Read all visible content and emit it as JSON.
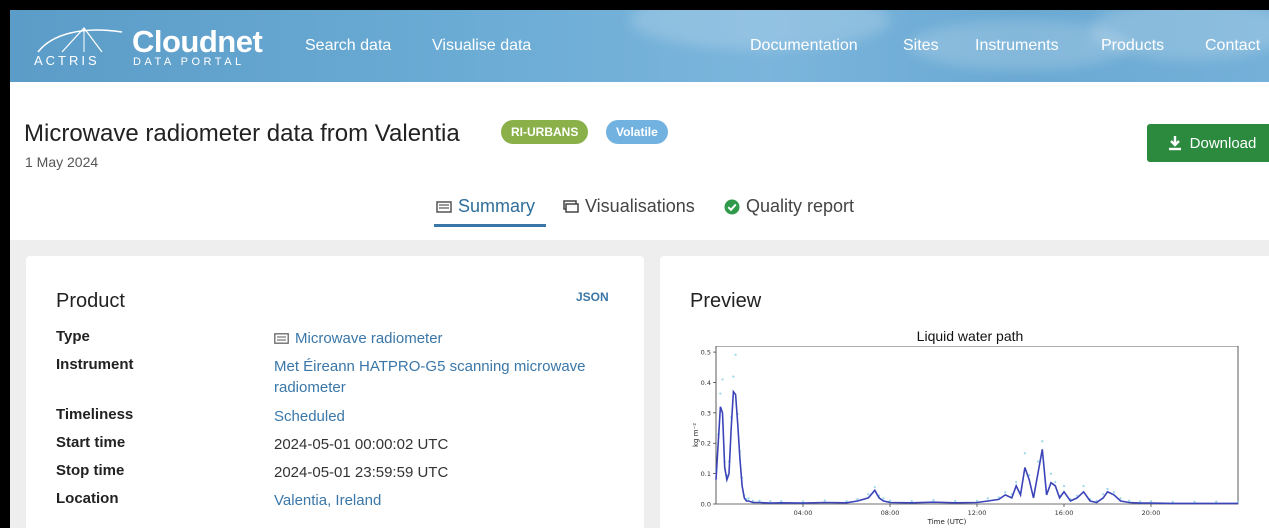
{
  "header": {
    "brand": "Cloudnet",
    "brand_sub": "DATA PORTAL",
    "org": "ACTRIS",
    "nav_left": [
      "Search data",
      "Visualise data"
    ],
    "nav_right": [
      "Documentation",
      "Sites",
      "Instruments",
      "Products",
      "Contact"
    ]
  },
  "page": {
    "title": "Microwave radiometer data from Valentia",
    "badges": [
      "RI-URBANS",
      "Volatile"
    ],
    "date": "1 May 2024",
    "download_label": "Download",
    "tabs": [
      "Summary",
      "Visualisations",
      "Quality report"
    ],
    "active_tab": "Summary"
  },
  "product": {
    "title": "Product",
    "json_label": "JSON",
    "rows": [
      {
        "key": "Type",
        "value": "Microwave radiometer",
        "link": true,
        "icon": "instrument-icon"
      },
      {
        "key": "Instrument",
        "value": "Met Éireann HATPRO-G5 scanning microwave radiometer",
        "link": true
      },
      {
        "key": "Timeliness",
        "value": "Scheduled",
        "link": true
      },
      {
        "key": "Start time",
        "value": "2024-05-01 00:00:02 UTC",
        "link": false
      },
      {
        "key": "Stop time",
        "value": "2024-05-01 23:59:59 UTC",
        "link": false
      },
      {
        "key": "Location",
        "value": "Valentia, Ireland",
        "link": true
      }
    ]
  },
  "preview": {
    "title": "Preview"
  },
  "colors": {
    "header": "#6aabd4",
    "link": "#3a77a8",
    "download": "#2b8a3e",
    "badge_green": "#8ab04a",
    "badge_blue": "#72b2e0",
    "series": "#3b44b8",
    "series_light": "#8fd3e8"
  },
  "chart_data": {
    "type": "line",
    "title": "Liquid water path",
    "xlabel": "Time (UTC)",
    "ylabel": "kg m⁻²",
    "xlim": [
      0,
      24
    ],
    "ylim": [
      0,
      0.52
    ],
    "xticks": [
      "04:00",
      "08:00",
      "12:00",
      "16:00",
      "20:00"
    ],
    "xtick_values": [
      4,
      8,
      12,
      16,
      20
    ],
    "yticks": [
      "0.0",
      "0.1",
      "0.2",
      "0.3",
      "0.4",
      "0.5"
    ],
    "ytick_values": [
      0,
      0.1,
      0.2,
      0.3,
      0.4,
      0.5
    ],
    "series": [
      {
        "x": [
          0.0,
          0.1,
          0.2,
          0.3,
          0.4,
          0.5,
          0.6,
          0.7,
          0.8,
          0.9,
          1.0,
          1.1,
          1.2,
          1.3,
          1.4,
          1.5,
          1.7,
          2.0,
          2.5,
          3.0,
          4.0,
          5.0,
          6.0,
          6.5,
          7.0,
          7.3,
          7.5,
          7.7,
          8.0,
          9.0,
          10.0,
          11.0,
          12.0,
          12.5,
          13.0,
          13.3,
          13.6,
          13.8,
          14.0,
          14.2,
          14.4,
          14.6,
          14.8,
          15.0,
          15.2,
          15.4,
          15.6,
          15.8,
          16.0,
          16.3,
          16.6,
          16.9,
          17.2,
          17.5,
          17.8,
          18.0,
          18.3,
          18.6,
          19.0,
          19.5,
          20.0,
          21.0,
          22.0,
          23.0,
          24.0
        ],
        "y": [
          0.08,
          0.2,
          0.32,
          0.3,
          0.12,
          0.08,
          0.1,
          0.25,
          0.37,
          0.36,
          0.26,
          0.15,
          0.06,
          0.02,
          0.01,
          0.01,
          0.005,
          0.005,
          0.003,
          0.004,
          0.003,
          0.005,
          0.004,
          0.01,
          0.02,
          0.045,
          0.02,
          0.01,
          0.005,
          0.004,
          0.006,
          0.004,
          0.005,
          0.01,
          0.015,
          0.03,
          0.02,
          0.06,
          0.03,
          0.12,
          0.08,
          0.02,
          0.1,
          0.18,
          0.03,
          0.07,
          0.06,
          0.02,
          0.04,
          0.01,
          0.02,
          0.04,
          0.01,
          0.005,
          0.02,
          0.04,
          0.03,
          0.01,
          0.005,
          0.003,
          0.003,
          0.002,
          0.002,
          0.002,
          0.002
        ]
      }
    ]
  }
}
